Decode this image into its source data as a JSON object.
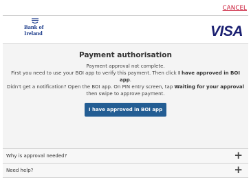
{
  "header": {
    "cancel_label": "CANCEL",
    "bank_name_line1": "Bank of",
    "bank_name_line2": "Ireland",
    "card_brand": "VISA"
  },
  "main": {
    "title": "Payment authorisation",
    "status": "Payment approval not complete.",
    "instruction_pre": "First you need to use your BOI app to verify this payment. Then click ",
    "instruction_bold": "I have approved in BOI app",
    "instruction_post": ".",
    "help_pre": "Didn't get a notification? Open the BOI app. On PIN entry screen, tap ",
    "help_bold": "Waiting for your approval",
    "help_post": " then swipe to approve payment.",
    "approve_button": "I have approved in BOI app"
  },
  "accordion": {
    "items": [
      {
        "label": "Why is approval needed?",
        "icon": "plus-icon"
      },
      {
        "label": "Need help?",
        "icon": "plus-icon"
      }
    ]
  },
  "colors": {
    "cancel": "#c8102e",
    "button": "#235d93",
    "boi_blue": "#1a3a8a",
    "visa_blue": "#1a1f71"
  }
}
